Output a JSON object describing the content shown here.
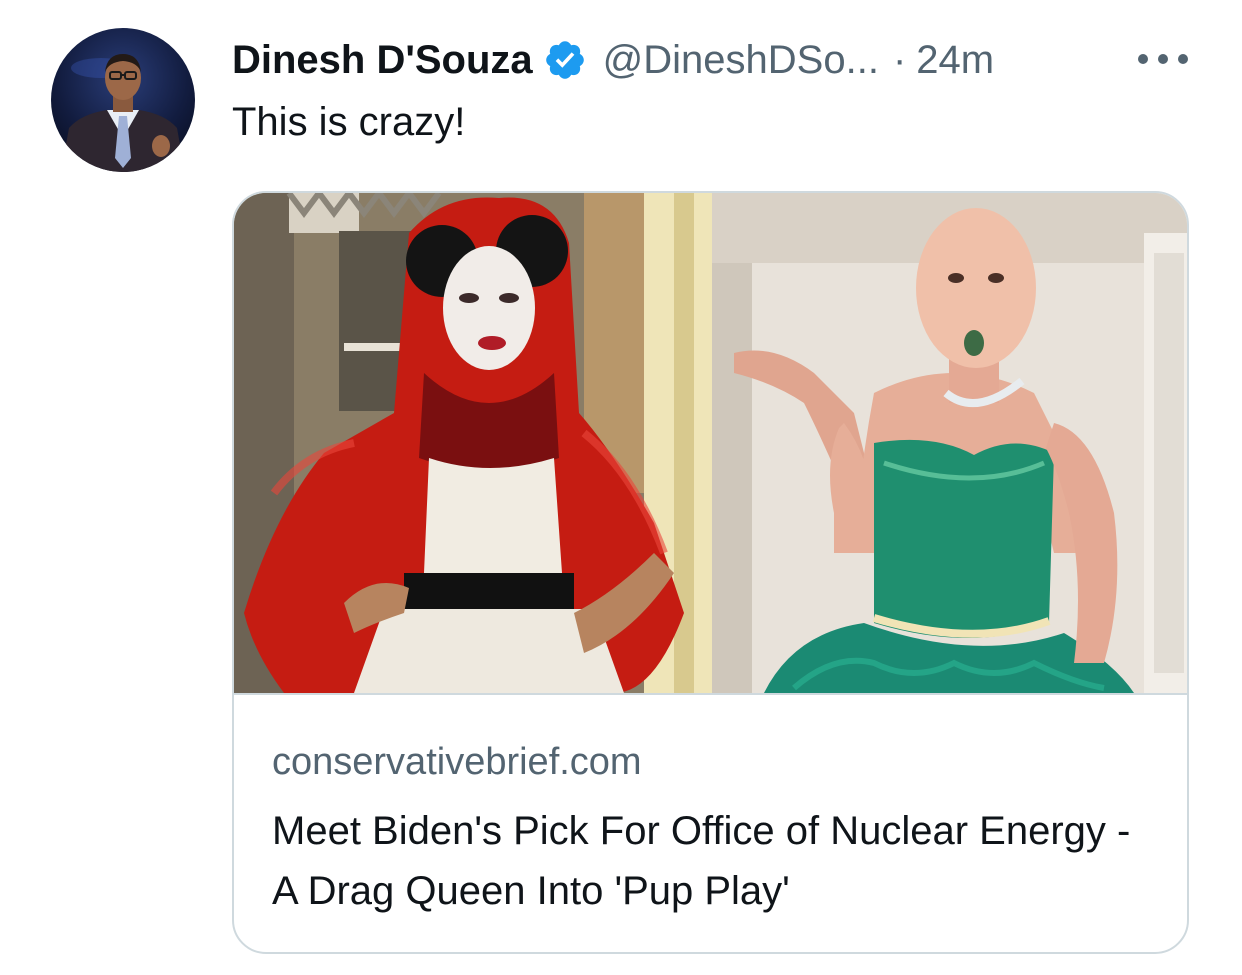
{
  "tweet": {
    "author_name": "Dinesh D'Souza",
    "verified_icon": "verified-badge-icon",
    "handle": "@DineshDSo...",
    "separator": "·",
    "time": "24m",
    "more_icon": "more-horizontal-icon",
    "text": "This is crazy!"
  },
  "card": {
    "domain": "conservativebrief.com",
    "title": "Meet Biden's Pick For Office of Nuclear Energy - A Drag Queen Into 'Pup Play'"
  },
  "colors": {
    "text_primary": "#0f1419",
    "text_secondary": "#536471",
    "verified_blue": "#1d9bf0",
    "card_border": "#cfd9de"
  }
}
